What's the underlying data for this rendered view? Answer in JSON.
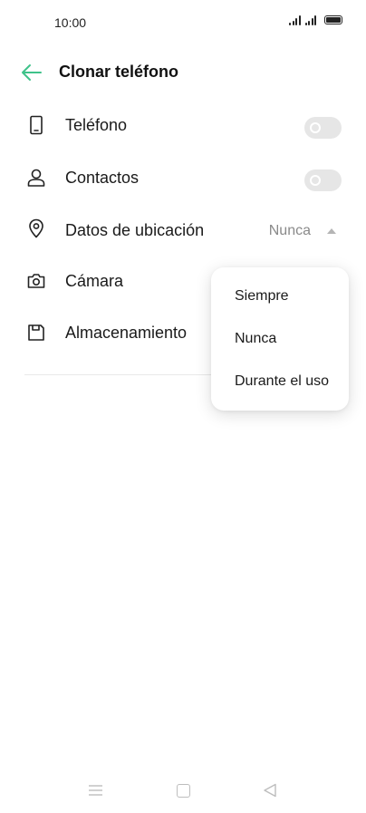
{
  "status_bar": {
    "time": "10:00"
  },
  "app_bar": {
    "title": "Clonar teléfono",
    "back_icon": "arrow-left-icon",
    "accent_color": "#3fc28a"
  },
  "settings": [
    {
      "label": "Teléfono",
      "icon": "phone-icon",
      "control": "toggle",
      "enabled": false
    },
    {
      "label": "Contactos",
      "icon": "contact-person-icon",
      "control": "toggle",
      "enabled": false
    },
    {
      "label": "Datos de ubicación",
      "icon": "location-pin-icon",
      "control": "dropdown",
      "value": "Nunca"
    },
    {
      "label": "Cámara",
      "icon": "camera-icon"
    },
    {
      "label": "Almacenamiento",
      "icon": "save-disk-icon"
    }
  ],
  "dropdown": {
    "open": true,
    "options": [
      "Siempre",
      "Nunca",
      "Durante el uso"
    ]
  },
  "nav_bar": {
    "icons": [
      "menu-icon",
      "home-square-icon",
      "back-triangle-icon"
    ]
  }
}
